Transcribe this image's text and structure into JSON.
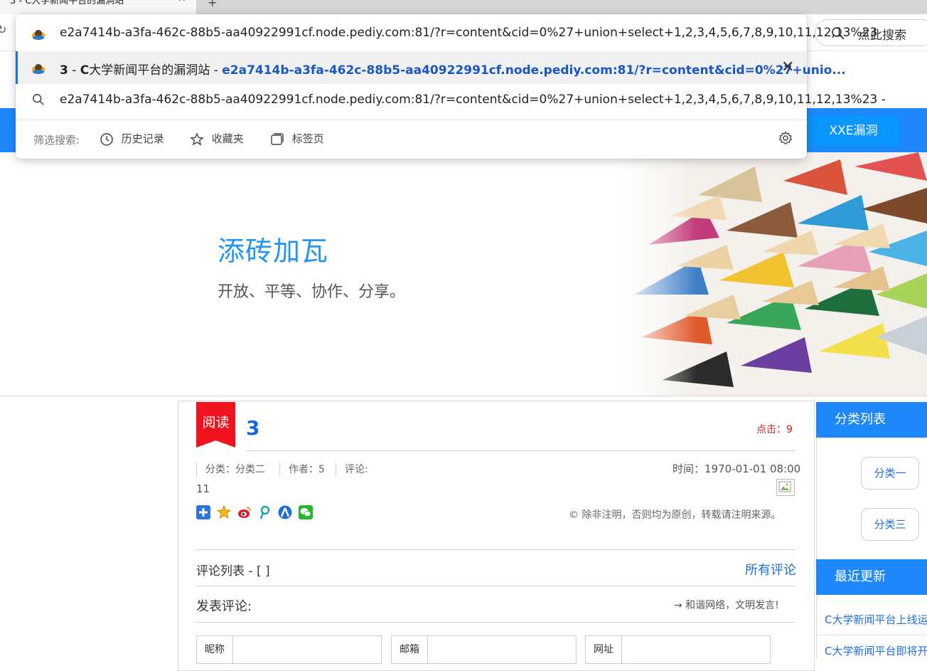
{
  "browser": {
    "tab_title": "3 - C大学新闻平台的漏洞站",
    "tab_close": "✕",
    "new_tab": "+",
    "search_placeholder": "点此搜索"
  },
  "omnibox": {
    "typed_url": "e2a7414b-a3fa-462c-88b5-aa40922991cf.node.pediy.com:81/?r=content&cid=0%27+union+select+1,2,3,4,5,6,7,8,9,10,11,12,13%23",
    "suggestion_title_prefix": "3",
    "suggestion_title_sep": " - ",
    "suggestion_title_c": "C",
    "suggestion_title_rest": "大学新闻平台的漏洞站",
    "suggestion_title_dash": " - ",
    "suggestion_url": "e2a7414b-a3fa-462c-88b5-aa40922991cf.node.pediy.com:81/?r=content&cid=0%27+unio...",
    "search_suggestion": "e2a7414b-a3fa-462c-88b5-aa40922991cf.node.pediy.com:81/?r=content&cid=0%27+union+select+1,2,3,4,5,6,7,8,9,10,11,12,13%23 -",
    "filter_label": "筛选搜索:",
    "filters": [
      "历史记录",
      "收藏夹",
      "标签页"
    ]
  },
  "site": {
    "nav_button": "XXE漏洞",
    "hero_title": "添砖加瓦",
    "hero_subtitle": "开放、平等、协作、分享。"
  },
  "article": {
    "ribbon": "阅读",
    "title": "3",
    "clicks": "点击：9",
    "category": "分类：分类二",
    "author": "作者：5",
    "comments_label": "评论:",
    "comments_value": "11",
    "time": "时间：1970-01-01 08:00",
    "copyright": "© 除非注明，否则均为原创，转载请注明来源。"
  },
  "comments": {
    "list_header": "评论列表 - [ ]",
    "all_link": "所有评论",
    "post_header": "发表评论:",
    "notice": "→ 和谐网络，文明发言!",
    "fields": [
      "昵称",
      "邮箱",
      "网址"
    ]
  },
  "sidebar": {
    "categories_title": "分类列表",
    "categories": [
      "分类一",
      "分类三"
    ],
    "recent_title": "最近更新",
    "recent": [
      "C大学新闻平台上线运",
      "C大学新闻平台即将开"
    ]
  },
  "colors": {
    "brand_blue": "#1e88fa",
    "link_blue": "#1e6fe0",
    "ribbon_red": "#f0131e"
  }
}
